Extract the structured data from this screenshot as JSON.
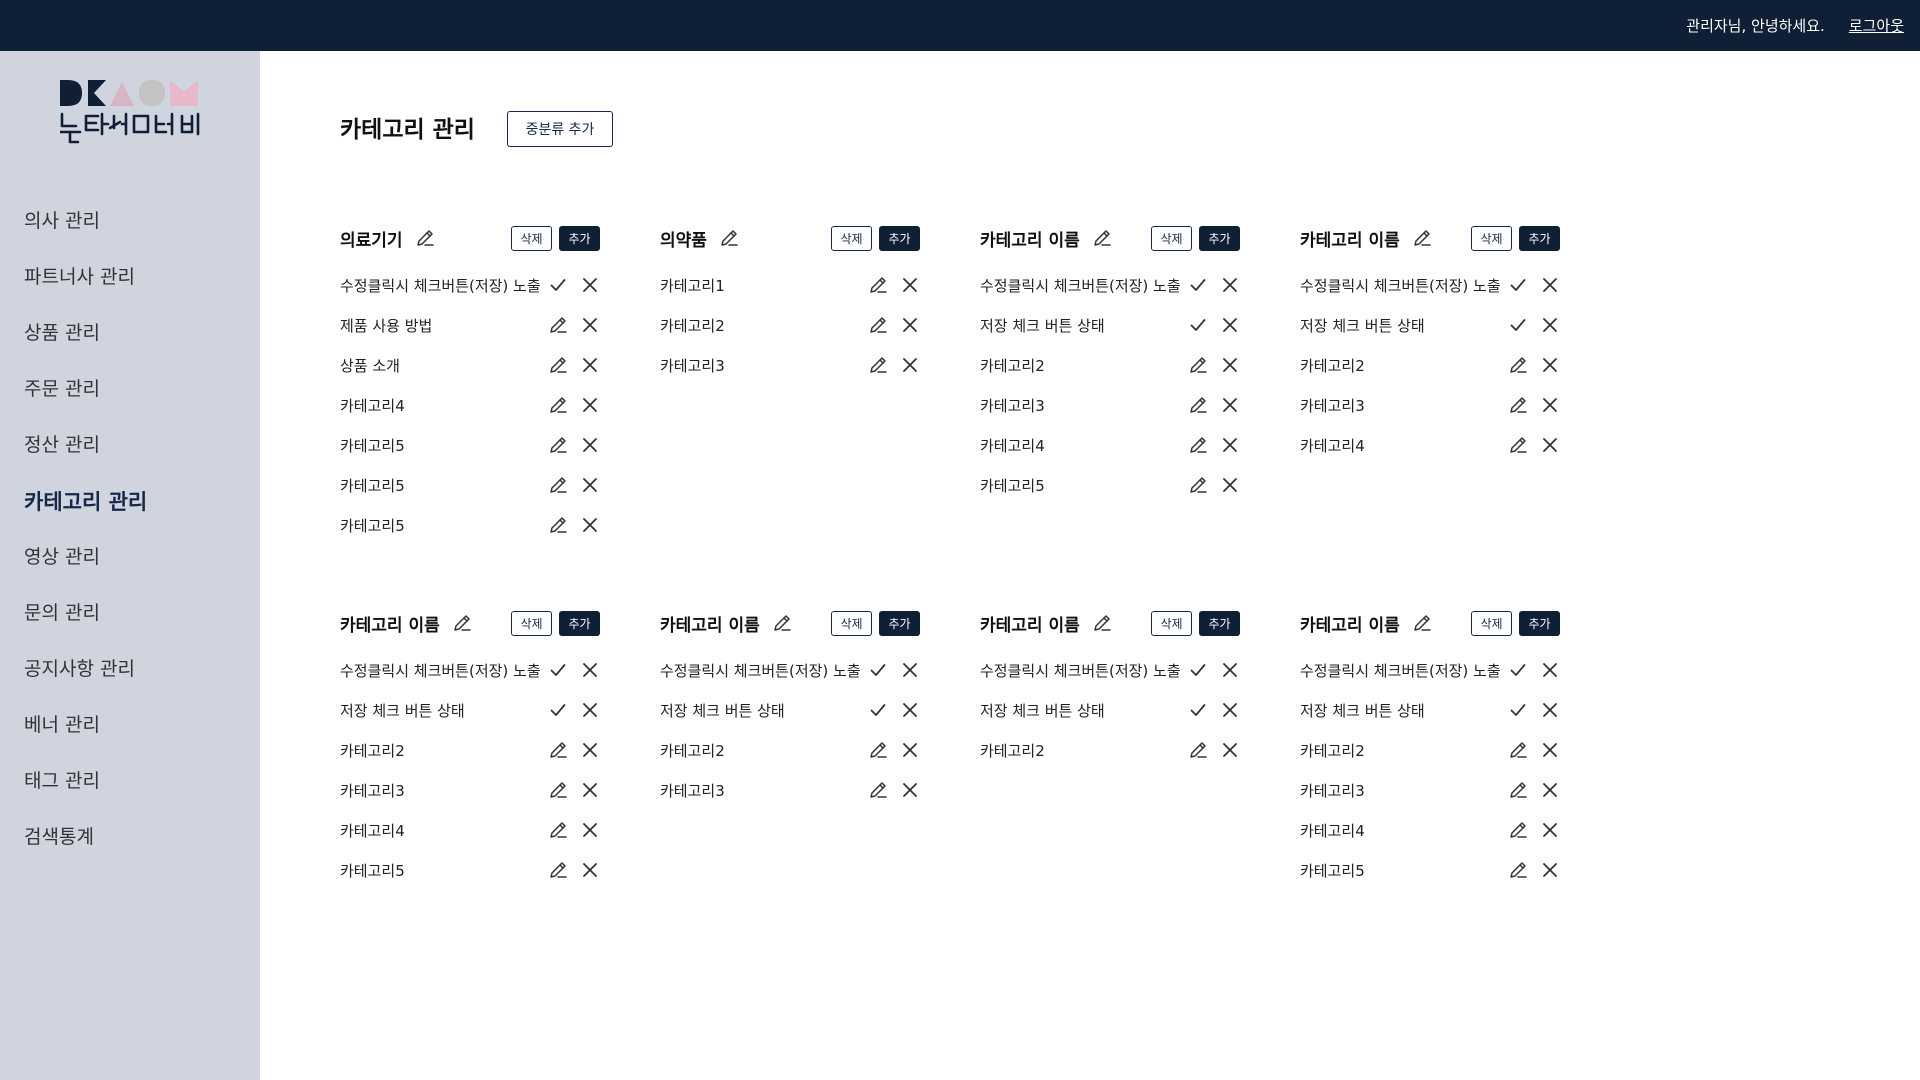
{
  "topbar": {
    "greeting": "관리자님, 안녕하세요.",
    "logout": "로그아웃"
  },
  "logo": {
    "text": "닥터세모비",
    "colors": [
      "#0f1f36",
      "#d9b5c3",
      "#c4c4c4",
      "#e6b8c9"
    ]
  },
  "sidebar": {
    "items": [
      {
        "label": "의사 관리"
      },
      {
        "label": "파트너사 관리"
      },
      {
        "label": "상품 관리"
      },
      {
        "label": "주문 관리"
      },
      {
        "label": "정산 관리"
      },
      {
        "label": "카테고리 관리",
        "active": true
      },
      {
        "label": "영상 관리"
      },
      {
        "label": "문의 관리"
      },
      {
        "label": "공지사항 관리"
      },
      {
        "label": "베너 관리"
      },
      {
        "label": "태그 관리"
      },
      {
        "label": "검색통계"
      }
    ]
  },
  "page": {
    "title": "카테고리 관리",
    "add_mid_label": "중분류 추가",
    "delete_label": "삭제",
    "add_label": "추가"
  },
  "colors": {
    "navy": "#0f1f36",
    "sidebar_bg": "#d0d4df"
  },
  "cards": [
    {
      "title": "의료기기",
      "rows": [
        {
          "label": "수정클릭시 체크버튼(저장) 노출",
          "state": "check"
        },
        {
          "label": "제품 사용 방법",
          "state": "edit"
        },
        {
          "label": "상품 소개",
          "state": "edit"
        },
        {
          "label": "카테고리4",
          "state": "edit"
        },
        {
          "label": "카테고리5",
          "state": "edit"
        },
        {
          "label": "카테고리5",
          "state": "edit"
        },
        {
          "label": "카테고리5",
          "state": "edit"
        }
      ]
    },
    {
      "title": "의약품",
      "rows": [
        {
          "label": "카테고리1",
          "state": "edit"
        },
        {
          "label": "카테고리2",
          "state": "edit"
        },
        {
          "label": "카테고리3",
          "state": "edit"
        }
      ]
    },
    {
      "title": "카테고리 이름",
      "rows": [
        {
          "label": "수정클릭시 체크버튼(저장) 노출",
          "state": "check"
        },
        {
          "label": "저장 체크 버튼 상태",
          "state": "check"
        },
        {
          "label": "카테고리2",
          "state": "edit"
        },
        {
          "label": "카테고리3",
          "state": "edit"
        },
        {
          "label": "카테고리4",
          "state": "edit"
        },
        {
          "label": "카테고리5",
          "state": "edit"
        }
      ]
    },
    {
      "title": "카테고리 이름",
      "rows": [
        {
          "label": "수정클릭시 체크버튼(저장) 노출",
          "state": "check"
        },
        {
          "label": "저장 체크 버튼 상태",
          "state": "check"
        },
        {
          "label": "카테고리2",
          "state": "edit"
        },
        {
          "label": "카테고리3",
          "state": "edit"
        },
        {
          "label": "카테고리4",
          "state": "edit"
        }
      ]
    },
    {
      "title": "카테고리 이름",
      "rows": [
        {
          "label": "수정클릭시 체크버튼(저장) 노출",
          "state": "check"
        },
        {
          "label": "저장 체크 버튼 상태",
          "state": "check"
        },
        {
          "label": "카테고리2",
          "state": "edit"
        },
        {
          "label": "카테고리3",
          "state": "edit"
        },
        {
          "label": "카테고리4",
          "state": "edit"
        },
        {
          "label": "카테고리5",
          "state": "edit"
        }
      ]
    },
    {
      "title": "카테고리 이름",
      "rows": [
        {
          "label": "수정클릭시 체크버튼(저장) 노출",
          "state": "check"
        },
        {
          "label": "저장 체크 버튼 상태",
          "state": "check"
        },
        {
          "label": "카테고리2",
          "state": "edit"
        },
        {
          "label": "카테고리3",
          "state": "edit"
        }
      ]
    },
    {
      "title": "카테고리 이름",
      "rows": [
        {
          "label": "수정클릭시 체크버튼(저장) 노출",
          "state": "check"
        },
        {
          "label": "저장 체크 버튼 상태",
          "state": "check"
        },
        {
          "label": "카테고리2",
          "state": "edit"
        }
      ]
    },
    {
      "title": "카테고리 이름",
      "rows": [
        {
          "label": "수정클릭시 체크버튼(저장) 노출",
          "state": "check"
        },
        {
          "label": "저장 체크 버튼 상태",
          "state": "check"
        },
        {
          "label": "카테고리2",
          "state": "edit"
        },
        {
          "label": "카테고리3",
          "state": "edit"
        },
        {
          "label": "카테고리4",
          "state": "edit"
        },
        {
          "label": "카테고리5",
          "state": "edit"
        }
      ]
    }
  ]
}
